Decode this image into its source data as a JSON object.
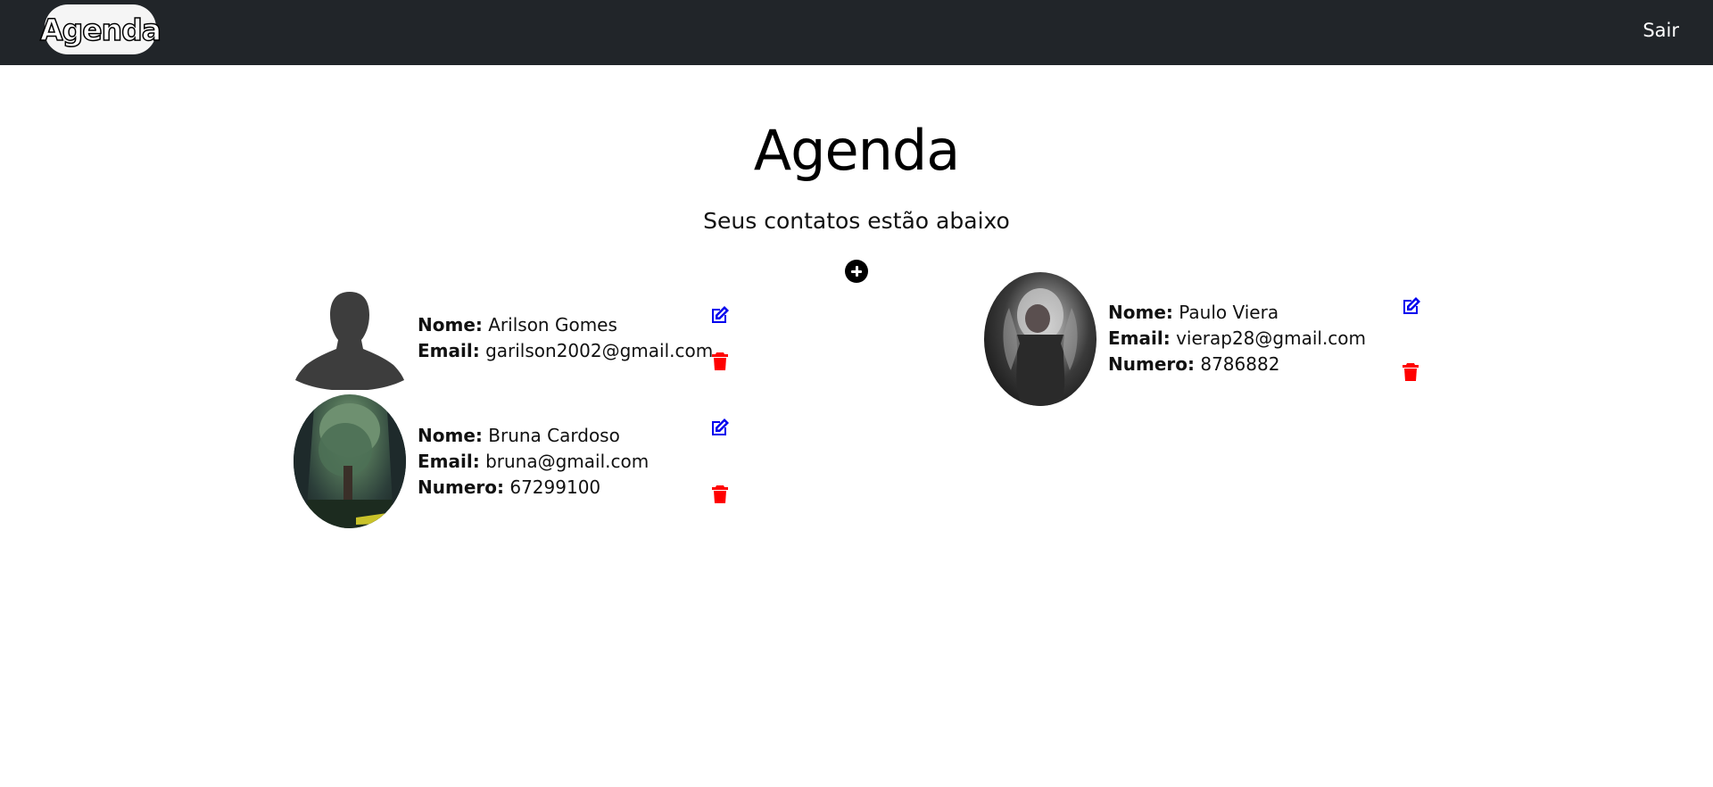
{
  "navbar": {
    "brand": "Agenda",
    "logout_label": "Sair",
    "background_color": "#212529"
  },
  "header": {
    "title": "Agenda",
    "subtitle": "Seus contatos estão abaixo"
  },
  "add_button_icon": "plus-circle-icon",
  "labels": {
    "name": "Nome:",
    "email": "Email:",
    "number": "Numero:"
  },
  "contacts": [
    {
      "name": "Arilson Gomes",
      "email": "garilson2002@gmail.com",
      "number": null,
      "avatar": "default-person-silhouette"
    },
    {
      "name": "Paulo Viera",
      "email": "vierap28@gmail.com",
      "number": "8786882",
      "avatar": "photo"
    },
    {
      "name": "Bruna Cardoso",
      "email": "bruna@gmail.com",
      "number": "67299100",
      "avatar": "photo"
    }
  ],
  "colors": {
    "edit_icon": "#0000ee",
    "delete_icon": "#ff0000"
  }
}
